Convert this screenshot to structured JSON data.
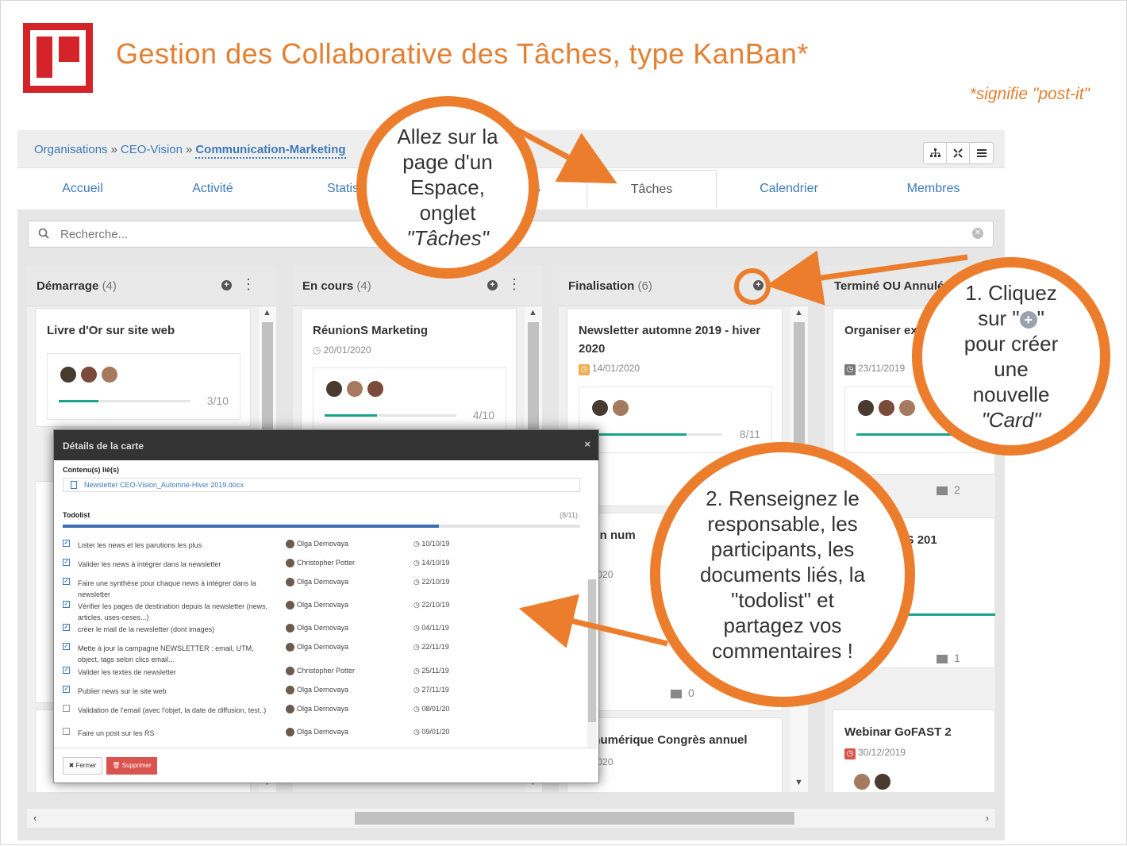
{
  "slide": {
    "title": "Gestion des Collaborative des Tâches, type KanBan*",
    "note": "*signifie \"post-it\"",
    "colors": {
      "accent": "#ec7d2c",
      "logo": "#d4242a",
      "link": "#3d7ab8",
      "progress": "#1aa38b"
    }
  },
  "breadcrumb": {
    "org": "Organisations",
    "sep": "»",
    "parent": "CEO-Vision",
    "current": "Communication-Marketing"
  },
  "toolbar_icons": [
    "sitemap-icon",
    "expand-icon",
    "menu-icon"
  ],
  "tabs": [
    {
      "label": "Accueil"
    },
    {
      "label": "Activité"
    },
    {
      "label": "Statis"
    },
    {
      "label": "s"
    },
    {
      "label": "Tâches",
      "active": true
    },
    {
      "label": "Calendrier"
    },
    {
      "label": "Membres"
    }
  ],
  "search": {
    "placeholder": "Recherche..."
  },
  "columns": [
    {
      "title": "Démarrage",
      "count": "(4)",
      "cards": [
        {
          "title": "Livre d'Or sur site web",
          "progress": 0.3,
          "ratio": "3/10"
        }
      ]
    },
    {
      "title": "En cours",
      "count": "(4)",
      "cards": [
        {
          "title": "RéunionS Marketing",
          "date": "20/01/2020",
          "progress": 0.4,
          "ratio": "4/10"
        }
      ]
    },
    {
      "title": "Finalisation",
      "count": "(6)",
      "cards": [
        {
          "title": "Newsletter automne 2019 - hiver 2020",
          "date": "14/01/2020",
          "progress": 0.727,
          "ratio": "8/11"
        },
        {
          "title": "ation num",
          "date": "01/2020",
          "comments": "0"
        },
        {
          "title": "er numérique Congrès annuel",
          "date": "01/2020"
        }
      ]
    },
    {
      "title": "Terminé OU Annulé",
      "count": "",
      "cards": [
        {
          "title": "Organiser exp 2019",
          "date": "23/11/2019",
          "comments": "2"
        },
        {
          "title": "EX au POSS 201",
          "comments": "1"
        },
        {
          "title": "Webinar GoFAST 2",
          "date": "30/12/2019"
        }
      ]
    }
  ],
  "modal": {
    "title": "Détails de la carte",
    "linked_label": "Contenu(s) lié(s)",
    "document": "Newsletter CEO-Vision_Automne-Hiver 2019.docx",
    "todo_label": "Todolist",
    "todo_count": "(8/11)",
    "todo_progress": 0.727,
    "items": [
      {
        "done": true,
        "text": "Lister les news et les parutions les plus",
        "who": "Olga Dernovaya",
        "date": "10/10/19"
      },
      {
        "done": true,
        "text": "Valider les news à intégrer dans la newsletter",
        "who": "Christopher Potter",
        "date": "14/10/19"
      },
      {
        "done": true,
        "text": "Faire une synthèse pour chaque news à intégrer dans la newsletter",
        "who": "Olga Dernovaya",
        "date": "22/10/19"
      },
      {
        "done": true,
        "text": "Vérifier les pages de destination depuis la newsletter (news, articles, uses-ceses...)",
        "who": "Olga Dernovaya",
        "date": "22/10/19"
      },
      {
        "done": true,
        "text": "créer le mail de la newsletter (dont images)",
        "who": "Olga Dernovaya",
        "date": "04/11/19"
      },
      {
        "done": true,
        "text": "Mette à jour la campagne NEWSLETTER : email, UTM, object, tags selon clics email...",
        "who": "Olga Dernovaya",
        "date": "22/11/19"
      },
      {
        "done": true,
        "text": "Valider les textes de newsletter",
        "who": "Christopher Potter",
        "date": "25/11/19"
      },
      {
        "done": true,
        "text": "Publier news sur le site web",
        "who": "Olga Dernovaya",
        "date": "27/11/19"
      },
      {
        "done": false,
        "text": "Validation de l'email (avec l'objet, la date de diffusion, test..)",
        "who": "Olga Dernovaya",
        "date": "08/01/20"
      },
      {
        "done": false,
        "text": "Faire un post sur les RS",
        "who": "Olga Dernovaya",
        "date": "09/01/20"
      }
    ],
    "close_label": "✖ Fermer",
    "delete_label": "🗑 Supprimer"
  },
  "annotations": {
    "tab_hint_1": "Allez sur la",
    "tab_hint_2": "page d'un",
    "tab_hint_3": "Espace,",
    "tab_hint_4": "onglet",
    "tab_hint_5": "\"Tâches\"",
    "add_hint_1": "1. Cliquez",
    "add_hint_2": "sur \"",
    "add_hint_3": "\"",
    "add_hint_4": "pour créer",
    "add_hint_5": "une",
    "add_hint_6": "nouvelle",
    "add_hint_7": "\"Card\"",
    "fill_hint_1": "2. Renseignez le",
    "fill_hint_2": "responsable, les",
    "fill_hint_3": "participants, les",
    "fill_hint_4": "documents liés, la",
    "fill_hint_5": "\"todolist\" et",
    "fill_hint_6": "partagez vos",
    "fill_hint_7": "commentaires !"
  }
}
